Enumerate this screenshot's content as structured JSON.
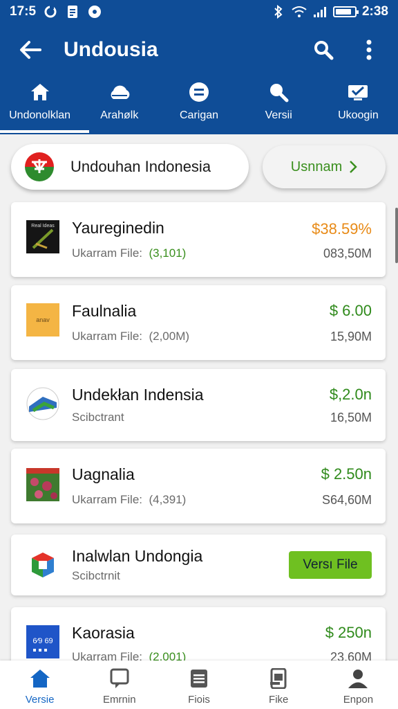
{
  "status": {
    "time_left": "17:5",
    "time_right": "2:38",
    "battery_level": 0.85
  },
  "appbar": {
    "title": "Undousia"
  },
  "tabs": [
    {
      "label": "Undonolklan",
      "icon": "home-icon",
      "active": true
    },
    {
      "label": "Arahølk",
      "icon": "cloud-icon",
      "active": false
    },
    {
      "label": "Carigan",
      "icon": "equals-circle-icon",
      "active": false
    },
    {
      "label": "Versii",
      "icon": "search-icon",
      "active": false
    },
    {
      "label": "Ukoogin",
      "icon": "mail-check-icon",
      "active": false
    }
  ],
  "featured": {
    "text": "Undouhan Indonesia",
    "button_label": "Usnnam"
  },
  "items": [
    {
      "name": "Yaureginedin",
      "sub_label": "Ukarram File:",
      "sub_count": "(3,101)",
      "price": "$38.59%",
      "size": "083,50M",
      "thumb": "thumb-book"
    },
    {
      "name": "Faulnalia",
      "sub_label": "Ukarram File:",
      "sub_count": "(2,00M)",
      "price": "$ 6.00",
      "size": "15,90M",
      "thumb": "thumb-yellow"
    },
    {
      "name": "Undekłan Indensia",
      "sub_label": "Scibctrant",
      "sub_count": "",
      "price": "$,2.0n",
      "size": "16,50M",
      "thumb": "thumb-circle"
    },
    {
      "name": "Uagnalia",
      "sub_label": "Ukarram File:",
      "sub_count": "(4,391)",
      "price": "$ 2.50n",
      "size": "S64,60M",
      "thumb": "thumb-flowers"
    },
    {
      "name": "Inalwlan Undongia",
      "sub_label": "Scibctrnit",
      "sub_count": "",
      "button_label": "Versı File",
      "thumb": "thumb-cube"
    },
    {
      "name": "Kaorasia",
      "sub_label": "Ukarram File:",
      "sub_count": "(2,001)",
      "price": "$ 250n",
      "size": "23,60M",
      "thumb": "thumb-blue"
    }
  ],
  "thumb_text": {
    "book": "Real Ideas",
    "yellow": "anav",
    "blue": "6⁄9 69"
  },
  "bottom_nav": [
    {
      "label": "Versie",
      "icon": "home-icon",
      "active": true
    },
    {
      "label": "Emrnin",
      "icon": "chat-icon",
      "active": false
    },
    {
      "label": "Fiois",
      "icon": "document-icon",
      "active": false
    },
    {
      "label": "Fike",
      "icon": "device-icon",
      "active": false
    },
    {
      "label": "Enpon",
      "icon": "person-icon",
      "active": false
    }
  ],
  "colors": {
    "primary": "#0f4d97",
    "accent_green": "#2f8a1b",
    "button_green": "#6fc021",
    "orange": "#e88a16",
    "nav_active": "#1466c4"
  }
}
